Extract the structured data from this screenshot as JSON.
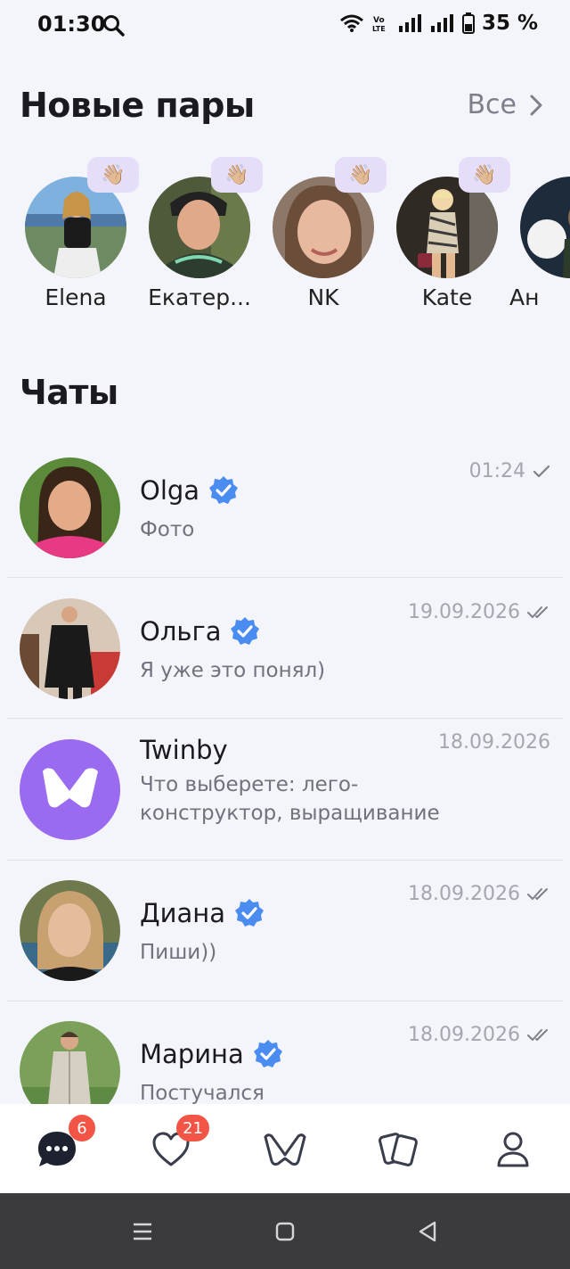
{
  "status_bar": {
    "time": "01:30",
    "battery": "35 %"
  },
  "new_pairs": {
    "title": "Новые пары",
    "all_label": "Все",
    "items": [
      {
        "name": "Elena",
        "wave": "👋🏼"
      },
      {
        "name": "Екатер...",
        "wave": "👋🏼"
      },
      {
        "name": "NK",
        "wave": "👋🏼"
      },
      {
        "name": "Kate",
        "wave": "👋🏼"
      },
      {
        "name": "Ан"
      }
    ]
  },
  "chats": {
    "title": "Чаты",
    "items": [
      {
        "name": "Olga",
        "verified": true,
        "message": "Фото",
        "time": "01:24",
        "status": "sent"
      },
      {
        "name": "Ольга",
        "verified": true,
        "message": "Я уже это понял)",
        "time": "19.09.2026",
        "status": "read"
      },
      {
        "name": "Twinby",
        "verified": false,
        "message": "Что выберете: лего-конструктор, выращивание",
        "time": "18.09.2026",
        "status": ""
      },
      {
        "name": "Диана",
        "verified": true,
        "message": "Пиши))",
        "time": "18.09.2026",
        "status": "read"
      },
      {
        "name": "Марина",
        "verified": true,
        "message": "Постучался",
        "time": "18.09.2026",
        "status": "read"
      }
    ]
  },
  "bottom_nav": {
    "chats_badge": "6",
    "likes_badge": "21",
    "items": [
      "chat-bubble-icon",
      "heart-icon",
      "twinby-logo-icon",
      "cards-icon",
      "profile-icon"
    ]
  },
  "colors": {
    "accent": "#9a6af0",
    "badge": "#f25545",
    "verified": "#4b8cf0"
  }
}
